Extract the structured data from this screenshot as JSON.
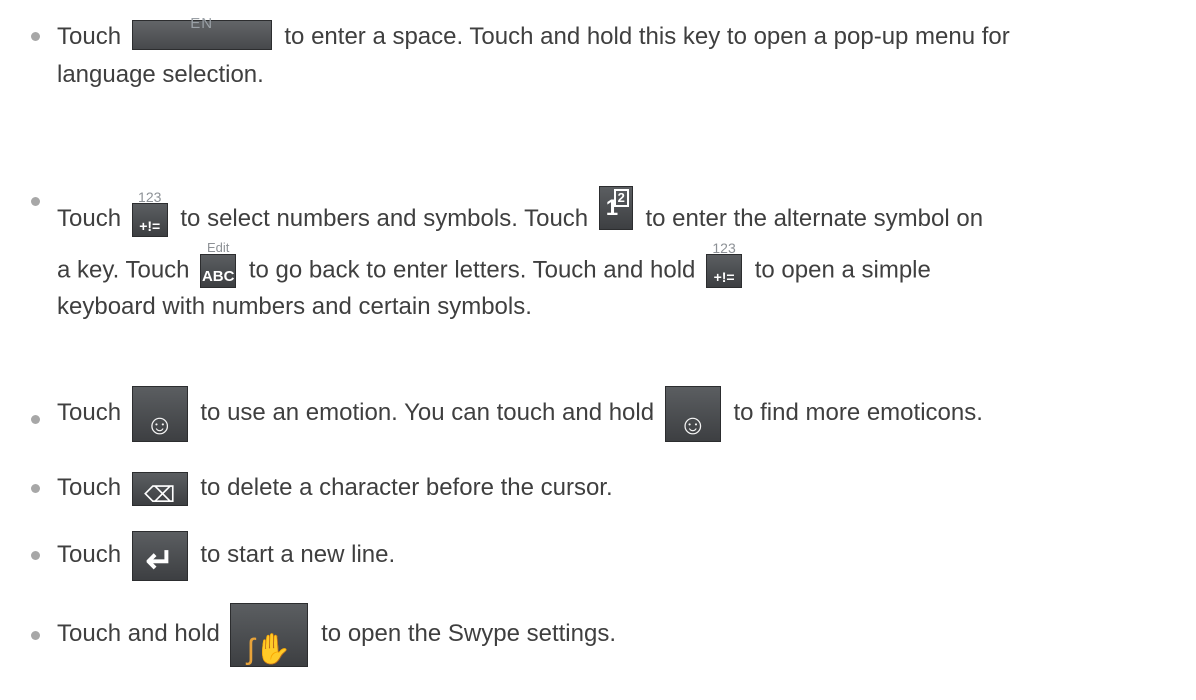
{
  "items": [
    {
      "parts": [
        "Touch",
        "to enter a space. Touch and hold this key to open a pop-up menu for",
        "language selection."
      ],
      "key": {
        "label": "EN",
        "icon": "space-key-icon"
      }
    },
    {
      "parts": [
        "Touch",
        "to select numbers and symbols. Touch",
        "to enter the alternate symbol on",
        "a key. Touch",
        "to go back to enter letters. Touch and hold",
        "to open a simple",
        "keyboard with numbers and certain symbols."
      ],
      "keys": {
        "num_top": "123",
        "num_main": "+!=",
        "alt_main": "1",
        "alt_sup": "2",
        "abc_top": "Edit",
        "abc_main": "ABC"
      }
    },
    {
      "parts": [
        "Touch",
        "to use an emotion. You can touch and hold",
        "to find more emoticons."
      ],
      "icon": "emoticon-key-icon"
    },
    {
      "parts": [
        "Touch",
        "to delete a character before the cursor."
      ],
      "icon": "delete-key-icon"
    },
    {
      "parts": [
        "Touch",
        "to start a new line."
      ],
      "icon": "enter-key-icon"
    },
    {
      "parts": [
        "Touch and hold",
        "to open the Swype settings."
      ],
      "icon": "swype-key-icon"
    }
  ]
}
